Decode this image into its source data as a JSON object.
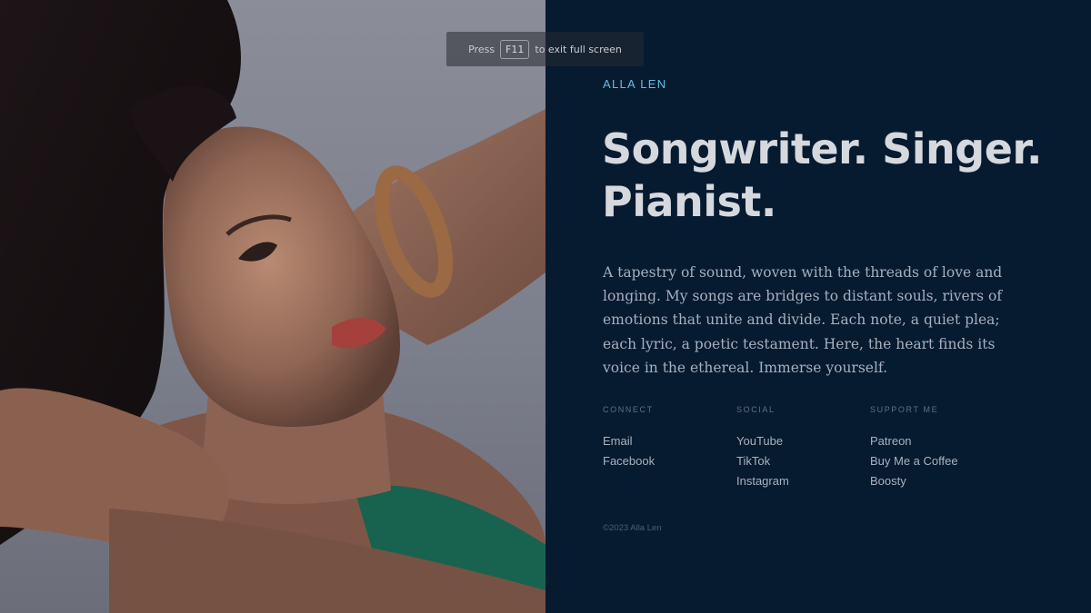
{
  "fullscreen_hint": {
    "prefix": "Press",
    "key": "F11",
    "suffix": "to exit full screen"
  },
  "hero": {
    "artist_name": "ALLA LEN",
    "headline_line1": "Songwriter. Singer.",
    "headline_line2": "Pianist.",
    "bio": "A tapestry of sound, woven with the threads of love and longing. My songs are bridges to distant souls, rivers of emotions that unite and divide. Each note, a quiet plea; each lyric, a poetic testament. Here, the heart finds its voice in the ethereal. Immerse yourself."
  },
  "links": {
    "connect": {
      "heading": "CONNECT",
      "items": [
        "Email",
        "Facebook"
      ]
    },
    "social": {
      "heading": "SOCIAL",
      "items": [
        "YouTube",
        "TikTok",
        "Instagram"
      ]
    },
    "support": {
      "heading": "SUPPORT ME",
      "items": [
        "Patreon",
        "Buy Me a Coffee",
        "Boosty"
      ]
    }
  },
  "footer": {
    "copyright": "©2023 Alla Len"
  },
  "colors": {
    "panel_background": "#061a30",
    "accent": "#5ec2de",
    "headline": "#d5d8dd"
  }
}
